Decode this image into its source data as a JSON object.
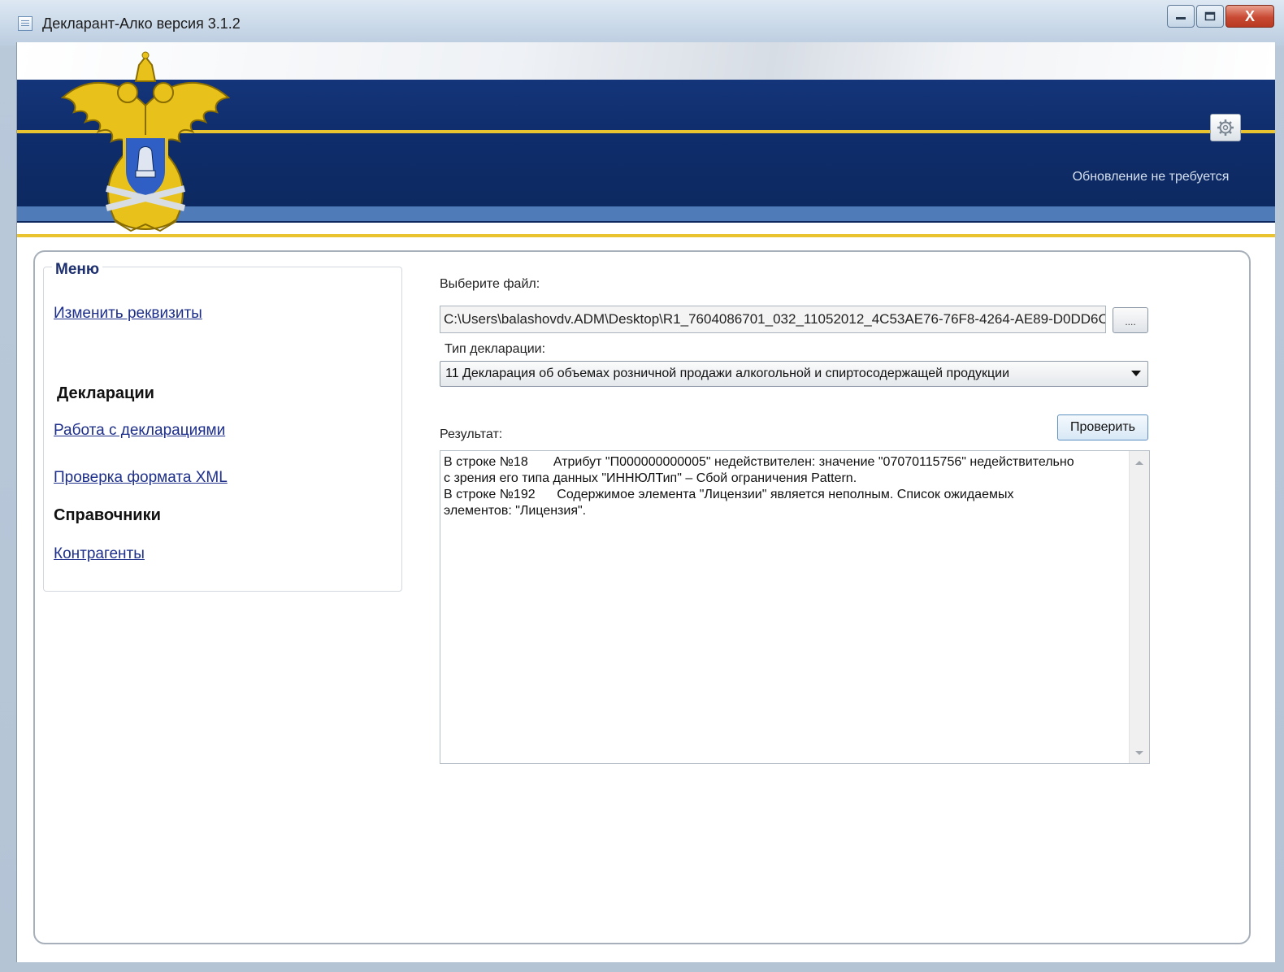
{
  "window": {
    "title": "Декларант-Алко версия 3.1.2",
    "controls": {
      "minimize_icon": "minimize-icon",
      "maximize_icon": "maximize-icon",
      "close_label": "X"
    }
  },
  "header": {
    "update_status": "Обновление не требуется",
    "settings_icon": "gear-icon",
    "colors": {
      "banner": "#0f2d6b",
      "gold": "#e9c330",
      "accent_blue": "#4f7bb8"
    }
  },
  "menu": {
    "legend": "Меню",
    "change_details": "Изменить реквизиты",
    "declarations_heading": "Декларации",
    "work_with_declarations": "Работа с декларациями",
    "xml_check": "Проверка формата XML",
    "references_heading": "Справочники",
    "counterparties": "Контрагенты"
  },
  "form": {
    "file_label": "Выберите файл:",
    "file_path": "C:\\Users\\balashovdv.ADM\\Desktop\\R1_7604086701_032_11052012_4C53AE76-76F8-4264-AE89-D0DD6C",
    "browse_label": "....",
    "declaration_type_label": "Тип декларации:",
    "declaration_type_value": "11 Декларация об объемах розничной продажи алкогольной и спиртосодержащей продукции",
    "check_button": "Проверить",
    "result_label": "Результат:",
    "result_lines": [
      "В строке №18       Атрибут \"П000000000005\" недействителен: значение \"07070115756\" недействительно",
      "с зрения его типа данных \"ИННЮЛТип\" – Сбой ограничения Pattern.",
      "В строке №192      Содержимое элемента \"Лицензии\" является неполным. Список ожидаемых",
      "элементов: \"Лицензия\"."
    ]
  }
}
